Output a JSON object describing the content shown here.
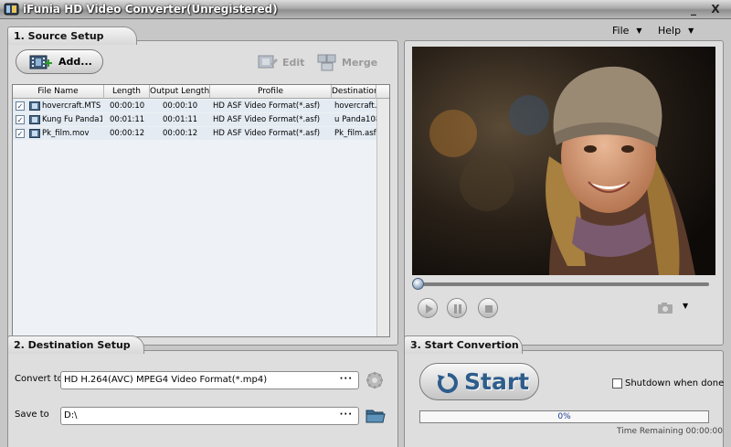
{
  "window": {
    "title": "iFunia HD Video Converter(Unregistered)",
    "minimize": "_",
    "close": "X"
  },
  "menu": {
    "file": "File",
    "help": "Help"
  },
  "source": {
    "tab": "1. Source Setup",
    "add_label": "Add...",
    "edit_label": "Edit",
    "merge_label": "Merge",
    "columns": [
      "File Name",
      "Length",
      "Output Length",
      "Profile",
      "Destination"
    ],
    "rows": [
      {
        "checked": true,
        "name": "hovercraft.MTS",
        "length": "00:00:10",
        "output": "00:00:10",
        "profile": "HD ASF Video Format(*.asf)",
        "dest": "hovercraft.as"
      },
      {
        "checked": true,
        "name": "Kung Fu Panda1(",
        "length": "00:01:11",
        "output": "00:01:11",
        "profile": "HD ASF Video Format(*.asf)",
        "dest": "u Panda108"
      },
      {
        "checked": true,
        "name": "Pk_film.mov",
        "length": "00:00:12",
        "output": "00:00:12",
        "profile": "HD ASF Video Format(*.asf)",
        "dest": "Pk_film.asf"
      }
    ]
  },
  "player": {
    "seek_fraction": 0.0
  },
  "destination": {
    "tab": "2. Destination Setup",
    "convert_to_label": "Convert to",
    "convert_to_value": "HD H.264(AVC) MPEG4 Video Format(*.mp4)",
    "save_to_label": "Save to",
    "save_to_value": "D:\\",
    "dots": "···"
  },
  "start": {
    "tab": "3. Start Convertion",
    "start_label": "Start",
    "shutdown_label": "Shutdown when done",
    "progress_text": "0%",
    "progress_fraction": 0.0,
    "time_remaining": "Time Remaining 00:00:00"
  },
  "icons": [
    "app-icon",
    "add-video-icon",
    "edit-icon",
    "merge-icon",
    "file-icon",
    "play-icon",
    "pause-icon",
    "stop-icon",
    "camera-icon",
    "settings-icon",
    "folder-icon",
    "refresh-icon"
  ]
}
